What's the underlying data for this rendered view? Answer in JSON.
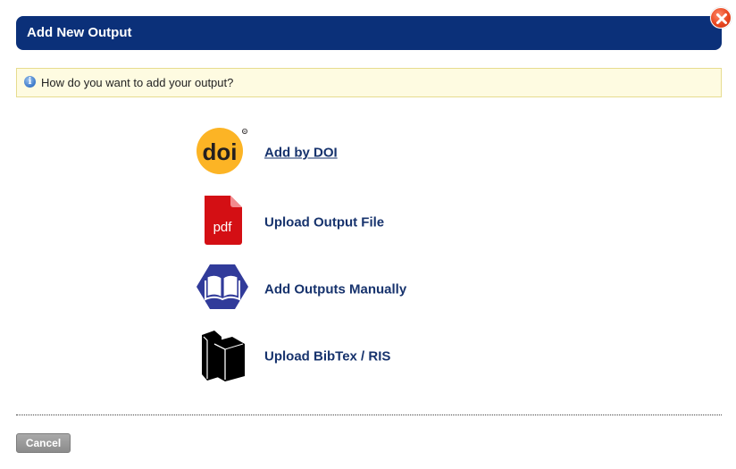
{
  "dialog": {
    "title": "Add New Output",
    "close_icon": "close-icon"
  },
  "info": {
    "icon": "info-icon",
    "icon_glyph": "i",
    "message": "How do you want to add your output?"
  },
  "options": [
    {
      "label": "Add by DOI",
      "icon": "doi-icon",
      "icon_text": "doi",
      "style": "link"
    },
    {
      "label": "Upload Output File",
      "icon": "pdf-file-icon",
      "icon_text": "pdf"
    },
    {
      "label": "Add Outputs Manually",
      "icon": "open-book-icon"
    },
    {
      "label": "Upload BibTex / RIS",
      "icon": "books-icon"
    }
  ],
  "footer": {
    "cancel_label": "Cancel"
  },
  "colors": {
    "title_bg": "#0b3079",
    "option_text": "#17336d",
    "info_bg": "#fefbe1",
    "doi_yellow": "#fcb425",
    "pdf_red": "#d40f14",
    "manual_hex": "#313b9a"
  }
}
